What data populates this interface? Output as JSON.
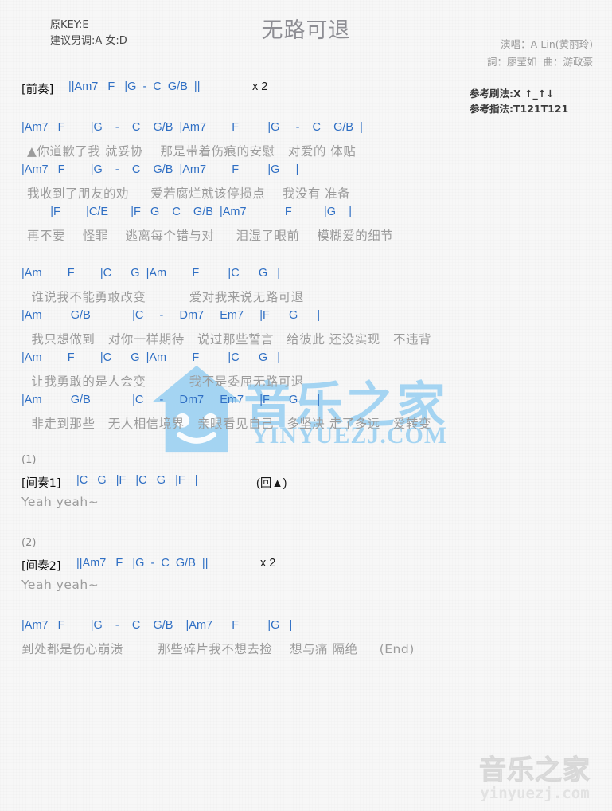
{
  "header": {
    "orig_key": "原KEY:E",
    "suggest_key": "建议男调:A 女:D",
    "title": "无路可退",
    "singer": "演唱：A-Lin(黄丽玲)",
    "writers": "詞：廖莹如  曲：游政豪",
    "strum_pattern": "参考刷法:X ↑_↑↓",
    "finger_pattern": "参考指法:T121T121"
  },
  "watermark": {
    "center_text": "音乐之家",
    "center_url": "YINYUEZJ.COM",
    "bottom_text": "音乐之家",
    "bottom_url": "yinyuezj.com"
  },
  "colors": {
    "chord": "#2f6fc4",
    "lyric": "#9c9c9c",
    "section": "#111111",
    "title": "#8d8d93",
    "watermark_blue": "#9ed2f2",
    "background": "#f7f7f7"
  },
  "sections": {
    "intro": {
      "label": "[前奏]",
      "chords": "||Am7   F   |G  -  C  G/B  ||",
      "repeat": "x 2"
    },
    "interlude1": {
      "marker": "(1)",
      "label": "[间奏1]",
      "chords": "|C   G   |F   |C   G   |F   |",
      "note": "(回▲)",
      "lyric": "Yeah yeah~"
    },
    "interlude2": {
      "marker": "(2)",
      "label": "[间奏2]",
      "chords": "||Am7   F   |G  -  C  G/B  ||",
      "repeat": "x 2",
      "lyric": "Yeah yeah~"
    }
  },
  "verse1": [
    {
      "chords": "|Am7   F        |G    -    C    G/B  |Am7        F         |G     -    C    G/B  |",
      "lyric": "▲你道歉了我 就妥协    那是带着伤痕的安慰   对爱的 体贴"
    },
    {
      "chords": "|Am7   F        |G    -    C    G/B  |Am7        F         |G     |",
      "lyric": "我收到了朋友的劝     爱若腐烂就该停损点    我没有 准备"
    },
    {
      "chords": "         |F        |C/E       |F   G    C    G/B  |Am7            F          |G    |",
      "lyric": "再不要    怪罪    逃离每个错与对     泪湿了眼前    模糊爱的细节"
    }
  ],
  "chorus1": [
    {
      "chords": "|Am        F        |C      G  |Am        F         |C      G   |",
      "lyric": " 谁说我不能勇敢改变          爱对我来说无路可退"
    },
    {
      "chords": "|Am         G/B             |C     -     Dm7     Em7     |F      G      |",
      "lyric": " 我只想做到   对你一样期待   说过那些誓言   给彼此 还没实现   不违背"
    }
  ],
  "chorus2": [
    {
      "chords": "|Am        F        |C      G  |Am        F         |C      G   |",
      "lyric": " 让我勇敢的是人会变          我不是委屈无路可退"
    },
    {
      "chords": "|Am         G/B             |C     -     Dm7     Em7     |F      G      |",
      "lyric": " 非走到那些   无人相信境界   亲眼看见自己   多坚决 走了多远   爱转变"
    }
  ],
  "ending": [
    {
      "chords": "|Am7   F        |G    -    C    G/B    |Am7      F         |G   |",
      "lyric": "到处都是伤心崩溃        那些碎片我不想去捡    想与痛 隔绝     (End)"
    }
  ]
}
